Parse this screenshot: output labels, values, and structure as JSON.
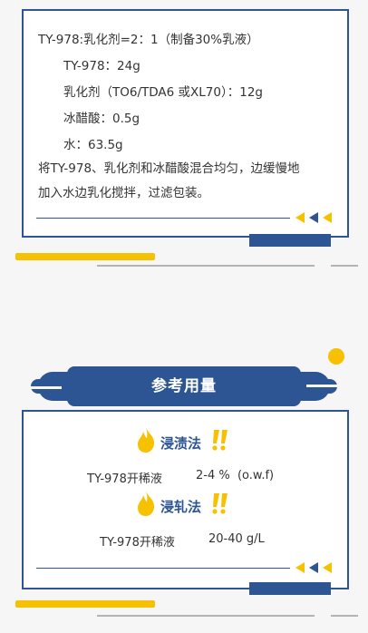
{
  "formula": {
    "title": "TY-978:乳化剂=2：1（制备30%乳液）",
    "items": [
      "TY-978：24g",
      "乳化剂（TO6/TDA6 或XL70）：12g",
      "冰醋酸：0.5g",
      "水：63.5g"
    ],
    "instruction_line1": "将TY-978、乳化剂和冰醋酸混合均匀，边缓慢地",
    "instruction_line2": "加入水边乳化搅拌，过滤包装。"
  },
  "section_header": {
    "title": "参考用量"
  },
  "methods": [
    {
      "name": "浸渍法",
      "product": "TY-978开稀液",
      "amount": "2-4 %  (o.w.f)"
    },
    {
      "name": "浸轧法",
      "product": "TY-978开稀液",
      "amount": "20-40 g/L"
    }
  ],
  "colors": {
    "navy": "#2d5593",
    "yellow": "#f6c100",
    "flame": "#f6c100",
    "gray_line": "#b3b3b3"
  },
  "icons": [
    "flame-icon",
    "double-exclamation-icon",
    "triangle-arrow-icon"
  ]
}
